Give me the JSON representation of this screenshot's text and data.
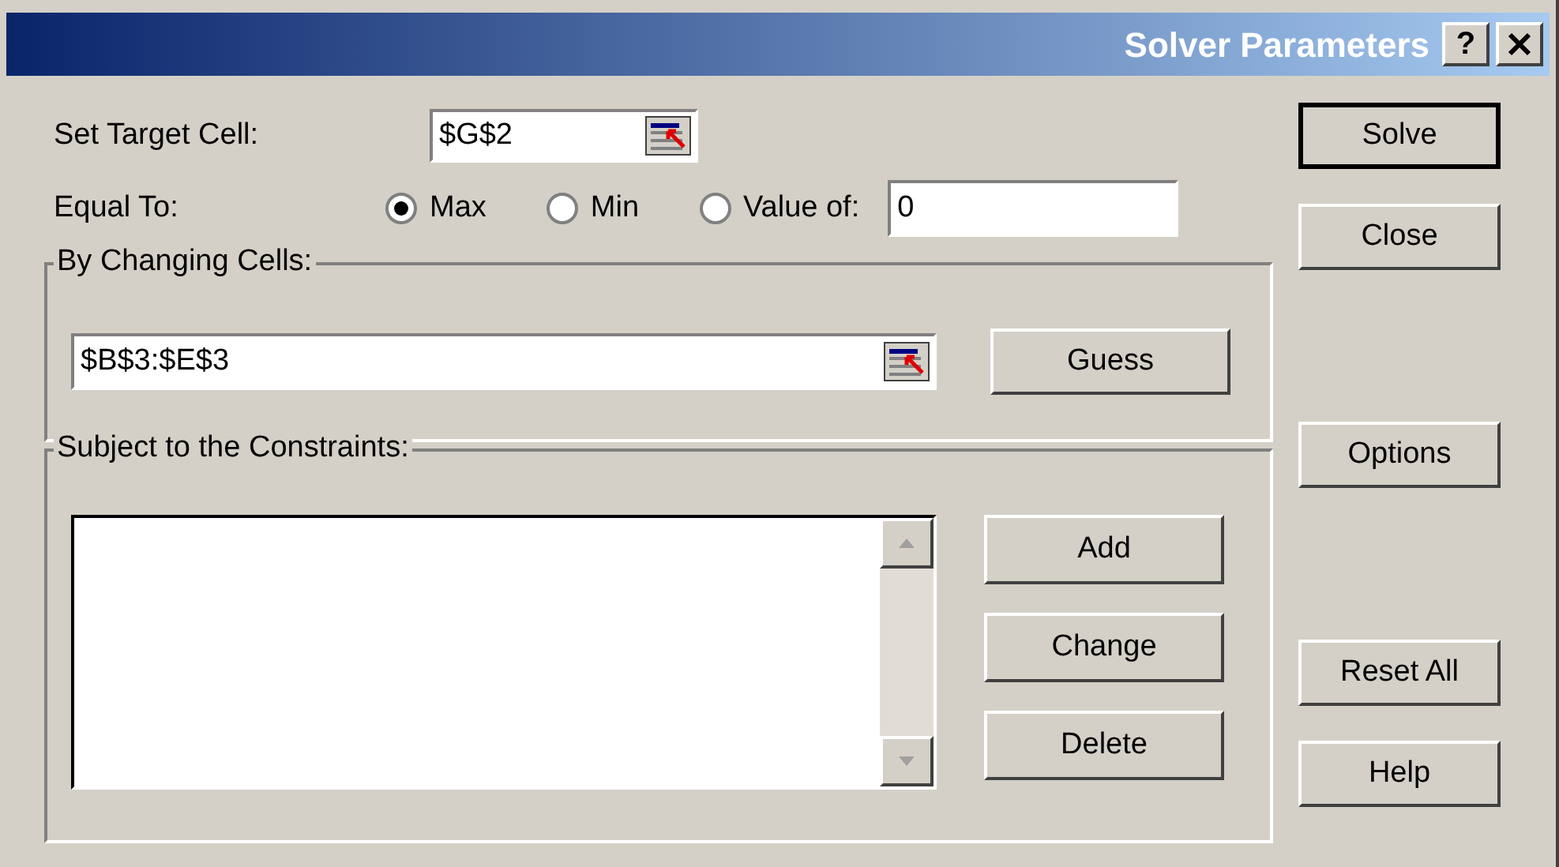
{
  "window": {
    "title": "Solver Parameters",
    "help_label": "?"
  },
  "target_cell": {
    "label": "Set Target Cell:",
    "value": "$G$2"
  },
  "equal_to": {
    "label": "Equal To:",
    "options": [
      {
        "label": "Max",
        "selected": true
      },
      {
        "label": "Min",
        "selected": false
      },
      {
        "label": "Value of:",
        "selected": false
      }
    ],
    "value": "0"
  },
  "changing_cells": {
    "title": "By Changing Cells:",
    "value": "$B$3:$E$3",
    "button": "Guess"
  },
  "constraints": {
    "title": "Subject to the Constraints:",
    "buttons": [
      "Add",
      "Change",
      "Delete"
    ]
  },
  "side_buttons": [
    {
      "label": "Solve",
      "default": true
    },
    {
      "label": "Close",
      "default": false
    },
    {
      "label": "Options",
      "default": false
    },
    {
      "label": "Reset All",
      "default": false
    },
    {
      "label": "Help",
      "default": false
    }
  ]
}
